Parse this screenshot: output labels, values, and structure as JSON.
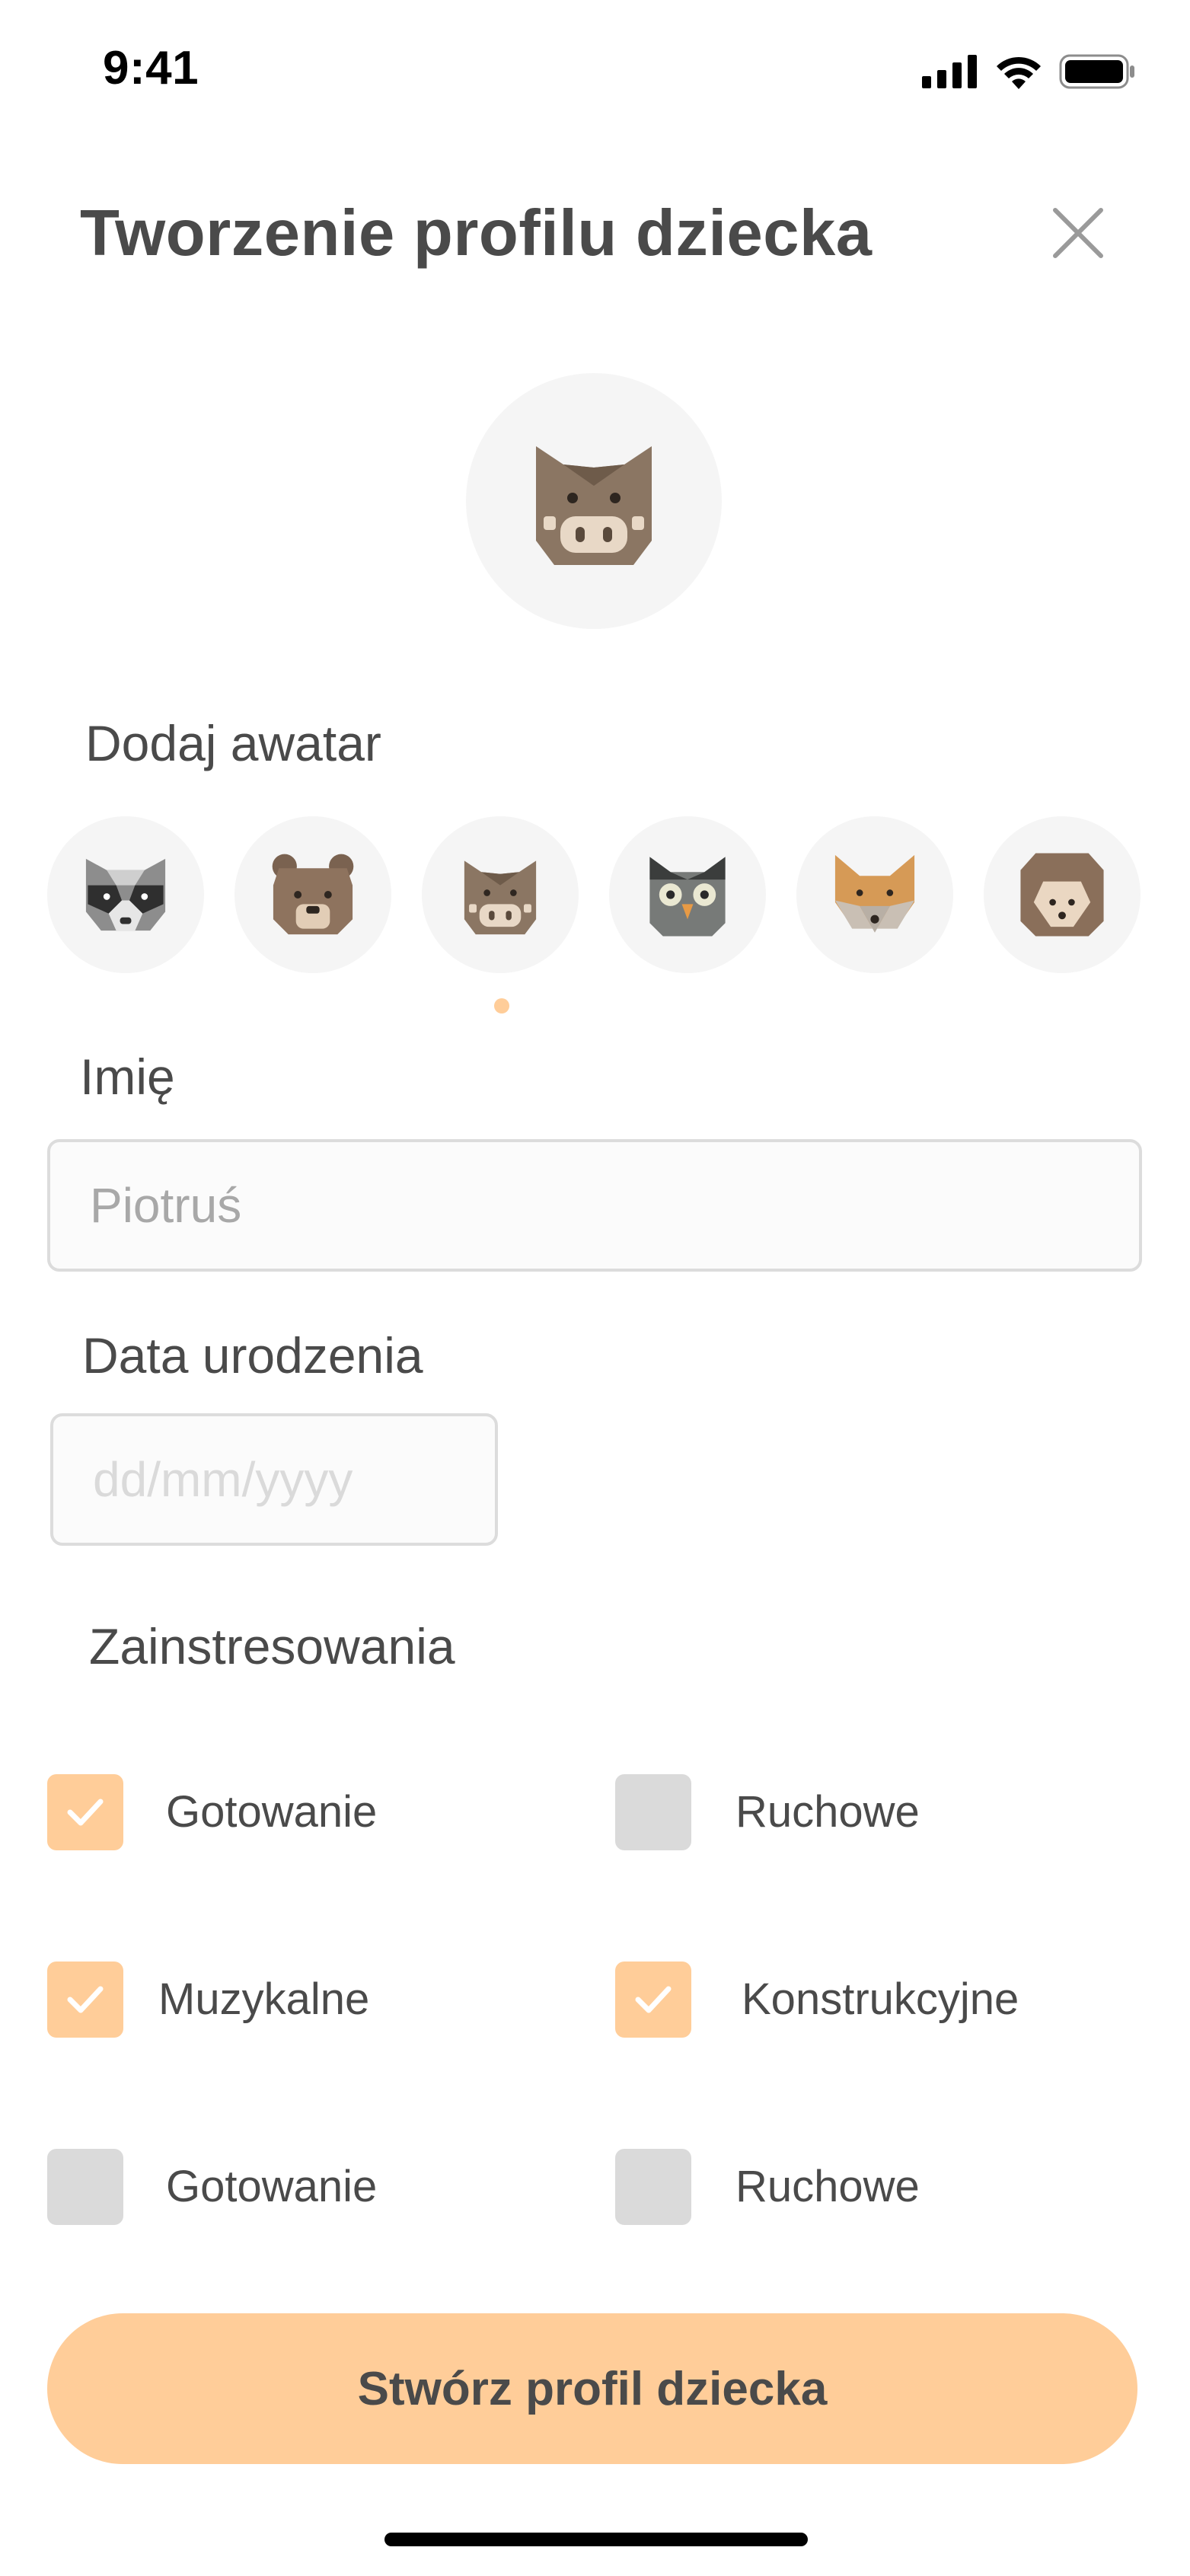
{
  "status_bar": {
    "time": "9:41",
    "signal_icon": "cellular-signal-icon",
    "wifi_icon": "wifi-icon",
    "battery_icon": "battery-icon"
  },
  "header": {
    "title": "Tworzenie profilu dziecka",
    "close_icon": "close-icon"
  },
  "avatar": {
    "current": "boar",
    "section_label": "Dodaj awatar",
    "options": [
      "raccoon",
      "bear",
      "boar",
      "owl",
      "fox",
      "hedgehog"
    ],
    "selected_index": 2
  },
  "name_field": {
    "label": "Imię",
    "placeholder": "Piotruś",
    "value": ""
  },
  "birthdate_field": {
    "label": "Data urodzenia",
    "placeholder": "dd/mm/yyyy",
    "value": ""
  },
  "interests": {
    "label": "Zainstresowania",
    "items": [
      {
        "label": "Gotowanie",
        "checked": true
      },
      {
        "label": "Ruchowe",
        "checked": false
      },
      {
        "label": "Muzykalne",
        "checked": true
      },
      {
        "label": "Konstrukcyjne",
        "checked": true
      },
      {
        "label": "Gotowanie",
        "checked": false
      },
      {
        "label": "Ruchowe",
        "checked": false
      }
    ]
  },
  "submit_button": {
    "label": "Stwórz profil dziecka"
  },
  "colors": {
    "accent": "#ffcd99",
    "text": "#4a4a4a",
    "unchecked": "#dadada",
    "avatar_bg": "#f5f5f5"
  }
}
